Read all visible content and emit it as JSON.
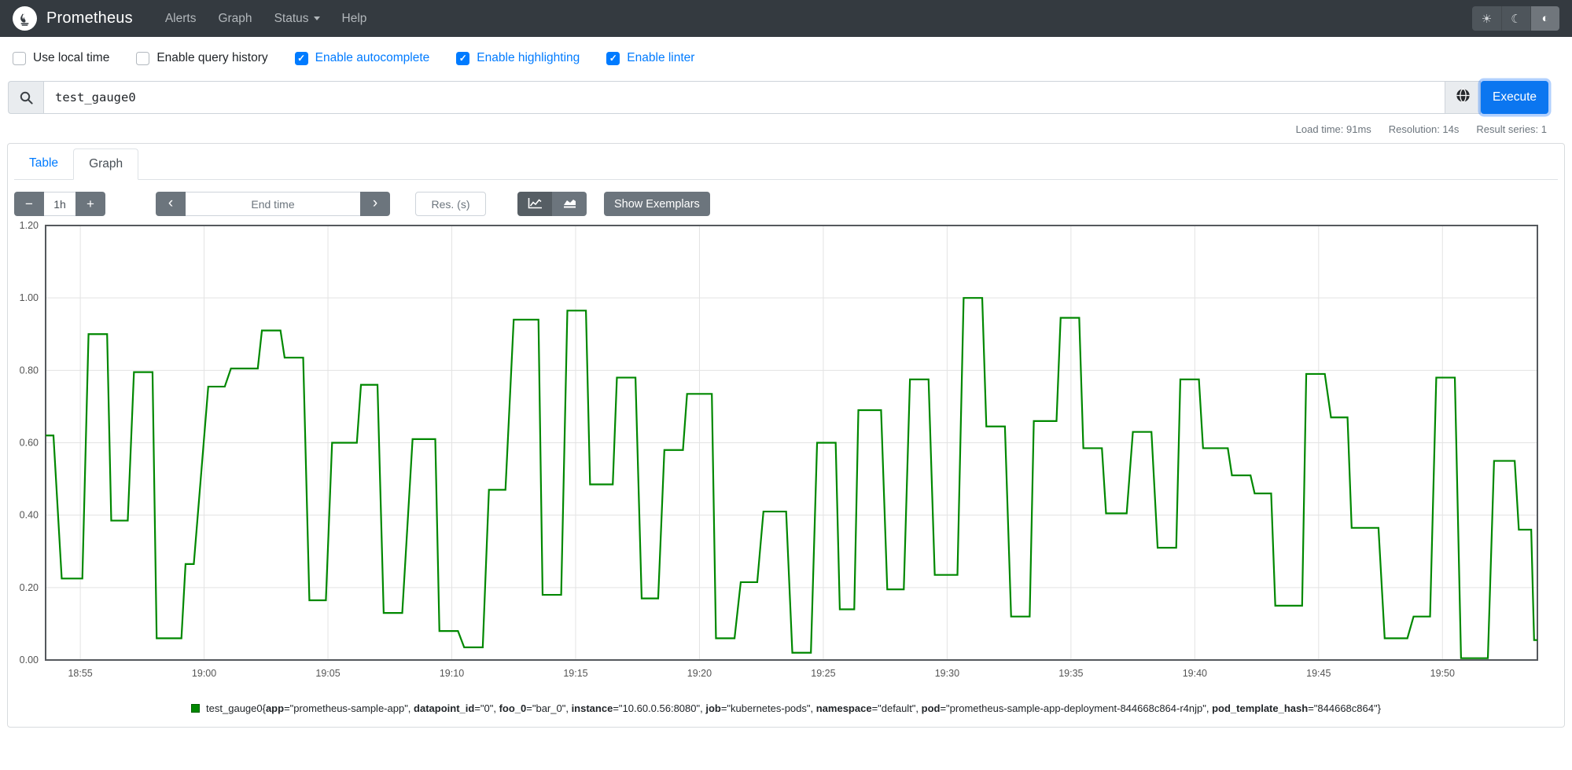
{
  "navbar": {
    "brand": "Prometheus",
    "items": [
      {
        "label": "Alerts"
      },
      {
        "label": "Graph"
      },
      {
        "label": "Status",
        "has_caret": true
      },
      {
        "label": "Help"
      }
    ],
    "theme": {
      "active": "auto"
    }
  },
  "options": [
    {
      "label": "Use local time",
      "checked": false
    },
    {
      "label": "Enable query history",
      "checked": false
    },
    {
      "label": "Enable autocomplete",
      "checked": true
    },
    {
      "label": "Enable highlighting",
      "checked": true
    },
    {
      "label": "Enable linter",
      "checked": true
    }
  ],
  "query": {
    "value": "test_gauge0",
    "execute_label": "Execute"
  },
  "stats": {
    "load_time": "Load time: 91ms",
    "resolution": "Resolution: 14s",
    "result_series": "Result series: 1"
  },
  "tabs": {
    "table": "Table",
    "graph": "Graph",
    "active": "Graph"
  },
  "controls": {
    "minus": "−",
    "duration": "1h",
    "plus": "+",
    "prev": "‹",
    "end_time_placeholder": "End time",
    "next": "›",
    "res_placeholder": "Res. (s)",
    "show_exemplars": "Show Exemplars"
  },
  "chart_data": {
    "type": "line",
    "series_name": "test_gauge0",
    "line_color": "#008800",
    "grid_color": "#e3e3e3",
    "border_color": "#55595d",
    "ylim": [
      0,
      1.2
    ],
    "y_ticks": [
      0.0,
      0.2,
      0.4,
      0.6,
      0.8,
      1.0,
      1.2
    ],
    "x_ticks": [
      "18:55",
      "19:00",
      "19:05",
      "19:10",
      "19:15",
      "19:20",
      "19:25",
      "19:30",
      "19:35",
      "19:40",
      "19:45",
      "19:50"
    ],
    "x_domain": [
      "18:53:36",
      "19:53:50"
    ],
    "plateaus": [
      [
        "18:53:36",
        "18:53:55",
        0.62
      ],
      [
        "18:54:15",
        "18:55:05",
        0.225
      ],
      [
        "18:55:20",
        "18:56:05",
        0.9
      ],
      [
        "18:56:15",
        "18:56:55",
        0.385
      ],
      [
        "18:57:10",
        "18:57:55",
        0.795
      ],
      [
        "18:58:05",
        "18:59:05",
        0.06
      ],
      [
        "18:59:15",
        "18:59:35",
        0.265
      ],
      [
        "19:00:10",
        "19:00:50",
        0.755
      ],
      [
        "19:01:05",
        "19:02:10",
        0.805
      ],
      [
        "19:02:20",
        "19:03:05",
        0.91
      ],
      [
        "19:03:15",
        "19:04:00",
        0.835
      ],
      [
        "19:04:15",
        "19:04:55",
        0.165
      ],
      [
        "19:05:10",
        "19:06:10",
        0.6
      ],
      [
        "19:06:20",
        "19:07:00",
        0.76
      ],
      [
        "19:07:15",
        "19:08:00",
        0.13
      ],
      [
        "19:08:25",
        "19:09:20",
        0.61
      ],
      [
        "19:09:30",
        "19:10:15",
        0.08
      ],
      [
        "19:10:30",
        "19:11:15",
        0.035
      ],
      [
        "19:11:30",
        "19:12:10",
        0.47
      ],
      [
        "19:12:30",
        "19:13:30",
        0.94
      ],
      [
        "19:13:40",
        "19:14:25",
        0.18
      ],
      [
        "19:14:40",
        "19:15:25",
        0.965
      ],
      [
        "19:15:35",
        "19:16:30",
        0.485
      ],
      [
        "19:16:40",
        "19:17:25",
        0.78
      ],
      [
        "19:17:40",
        "19:18:20",
        0.17
      ],
      [
        "19:18:35",
        "19:19:20",
        0.58
      ],
      [
        "19:19:30",
        "19:20:30",
        0.735
      ],
      [
        "19:20:40",
        "19:21:25",
        0.06
      ],
      [
        "19:21:40",
        "19:22:20",
        0.215
      ],
      [
        "19:22:35",
        "19:23:30",
        0.41
      ],
      [
        "19:23:45",
        "19:24:30",
        0.02
      ],
      [
        "19:24:45",
        "19:25:30",
        0.6
      ],
      [
        "19:25:40",
        "19:26:15",
        0.14
      ],
      [
        "19:26:25",
        "19:27:20",
        0.69
      ],
      [
        "19:27:35",
        "19:28:15",
        0.195
      ],
      [
        "19:28:30",
        "19:29:15",
        0.775
      ],
      [
        "19:29:30",
        "19:30:25",
        0.235
      ],
      [
        "19:30:40",
        "19:31:25",
        1.0
      ],
      [
        "19:31:35",
        "19:32:20",
        0.645
      ],
      [
        "19:32:35",
        "19:33:20",
        0.12
      ],
      [
        "19:33:30",
        "19:34:25",
        0.66
      ],
      [
        "19:34:35",
        "19:35:20",
        0.945
      ],
      [
        "19:35:30",
        "19:36:15",
        0.585
      ],
      [
        "19:36:25",
        "19:37:15",
        0.405
      ],
      [
        "19:37:30",
        "19:38:15",
        0.63
      ],
      [
        "19:38:30",
        "19:39:15",
        0.31
      ],
      [
        "19:39:25",
        "19:40:10",
        0.775
      ],
      [
        "19:40:20",
        "19:41:20",
        0.585
      ],
      [
        "19:41:30",
        "19:42:15",
        0.51
      ],
      [
        "19:42:25",
        "19:43:05",
        0.46
      ],
      [
        "19:43:15",
        "19:44:20",
        0.15
      ],
      [
        "19:44:30",
        "19:45:15",
        0.79
      ],
      [
        "19:45:30",
        "19:46:10",
        0.67
      ],
      [
        "19:46:20",
        "19:47:25",
        0.365
      ],
      [
        "19:47:40",
        "19:48:35",
        0.06
      ],
      [
        "19:48:50",
        "19:49:30",
        0.12
      ],
      [
        "19:49:45",
        "19:50:30",
        0.78
      ],
      [
        "19:50:45",
        "19:51:50",
        0.005
      ],
      [
        "19:52:05",
        "19:52:55",
        0.55
      ],
      [
        "19:53:05",
        "19:53:35",
        0.36
      ],
      [
        "19:53:42",
        "19:53:50",
        0.055
      ]
    ],
    "labels": [
      {
        "name": "app",
        "value": "prometheus-sample-app"
      },
      {
        "name": "datapoint_id",
        "value": "0"
      },
      {
        "name": "foo_0",
        "value": "bar_0"
      },
      {
        "name": "instance",
        "value": "10.60.0.56:8080"
      },
      {
        "name": "job",
        "value": "kubernetes-pods"
      },
      {
        "name": "namespace",
        "value": "default"
      },
      {
        "name": "pod",
        "value": "prometheus-sample-app-deployment-844668c864-r4njp"
      },
      {
        "name": "pod_template_hash",
        "value": "844668c864"
      }
    ]
  }
}
